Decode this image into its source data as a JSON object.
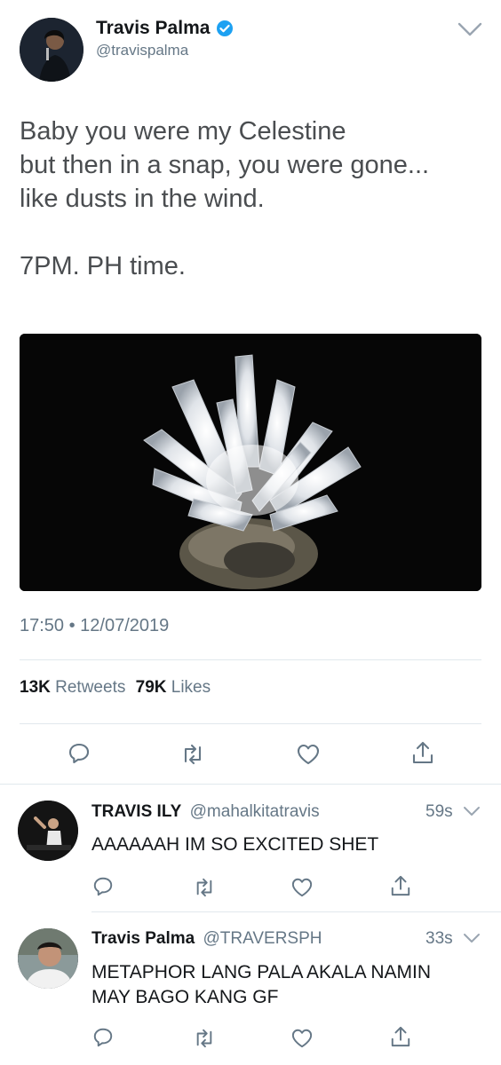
{
  "main_tweet": {
    "display_name": "Travis Palma",
    "handle": "@travispalma",
    "text_lines": [
      "Baby you were my Celestine",
      "but then in a snap, you were gone...",
      "like dusts in the wind.",
      "",
      "7PM. PH time."
    ],
    "timestamp": "17:50 • 12/07/2019",
    "stats": {
      "retweets_count": "13K",
      "retweets_label": "Retweets",
      "likes_count": "79K",
      "likes_label": "Likes"
    }
  },
  "replies": [
    {
      "display_name": "TRAVIS ILY",
      "handle": "@mahalkitatravis",
      "time": "59s",
      "text": "AAAAAAH IM SO EXCITED SHET"
    },
    {
      "display_name": "Travis Palma",
      "handle": "@TRAVERSPH",
      "time": "33s",
      "text_lines": [
        "METAPHOR LANG PALA AKALA NAMIN",
        "MAY BAGO KANG GF"
      ]
    }
  ],
  "icons": {
    "verified": "verified-badge-icon",
    "menu": "chevron-down-icon",
    "reply": "reply-icon",
    "retweet": "retweet-icon",
    "like": "heart-icon",
    "share": "share-icon"
  },
  "colors": {
    "verified": "#1da1f2",
    "text": "#14171a",
    "muted": "#657786",
    "divider": "#e1e8ed"
  }
}
